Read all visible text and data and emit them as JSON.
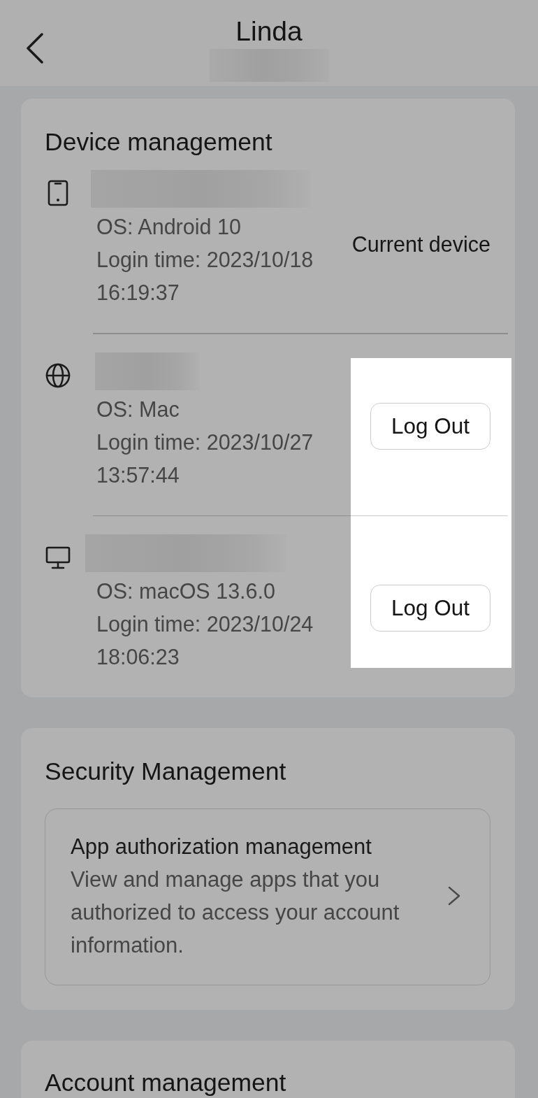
{
  "header": {
    "title": "Linda"
  },
  "sections": [
    {
      "kind": "devices",
      "title": "Device management",
      "devices": [
        {
          "kind": "mobile",
          "os": "OS: Android 10",
          "login_time": "Login time: 2023/10/18 16:19:37",
          "action": {
            "kind": "label",
            "text": "Current device"
          },
          "highlighted": false
        },
        {
          "kind": "web",
          "os": "OS: Mac",
          "login_time": "Login time: 2023/10/27 13:57:44",
          "action": {
            "kind": "button",
            "text": "Log Out"
          },
          "highlighted": true
        },
        {
          "kind": "desktop",
          "os": "OS: macOS 13.6.0",
          "login_time": "Login time: 2023/10/24 18:06:23",
          "action": {
            "kind": "button",
            "text": "Log Out"
          },
          "highlighted": true
        }
      ]
    },
    {
      "kind": "links",
      "title": "Security Management",
      "items": [
        {
          "title": "App authorization management",
          "description": "View and manage apps that you authorized to access your account information."
        }
      ]
    },
    {
      "kind": "links",
      "title": "Account management"
    }
  ]
}
